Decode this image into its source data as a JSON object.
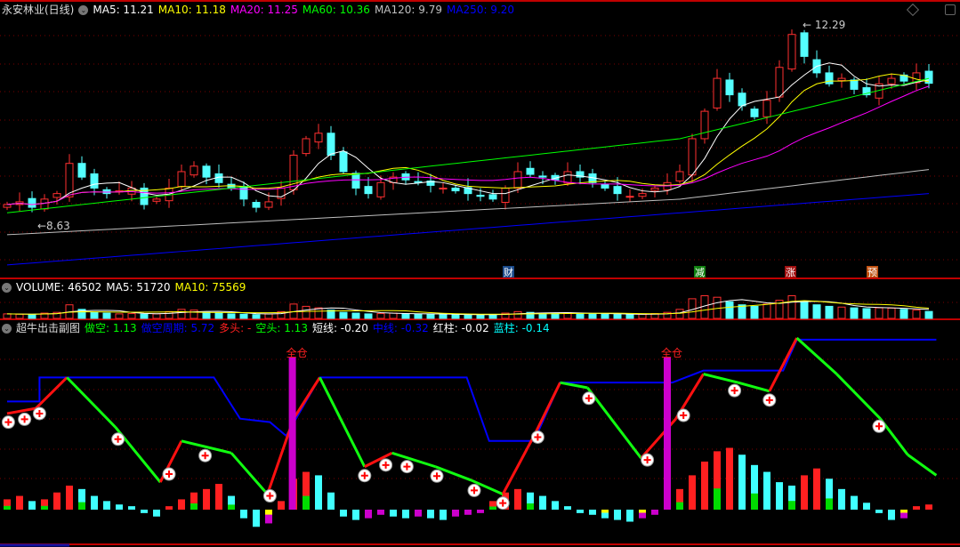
{
  "main": {
    "title": "永安林业(日线)",
    "ma": [
      {
        "label": "MA5: 11.21",
        "color": "#ffffff"
      },
      {
        "label": "MA10: 11.18",
        "color": "#ffff00"
      },
      {
        "label": "MA20: 11.25",
        "color": "#ff00ff"
      },
      {
        "label": "MA60: 10.36",
        "color": "#00ff00"
      },
      {
        "label": "MA120: 9.79",
        "color": "#c0c0c0"
      },
      {
        "label": "MA250: 9.20",
        "color": "#0000ff"
      }
    ],
    "high_label": "12.29",
    "low_label": "8.63",
    "events": [
      {
        "label": "财",
        "color": "#1a4a8a"
      },
      {
        "label": "减",
        "color": "#108010"
      },
      {
        "label": "涨",
        "color": "#a01010"
      },
      {
        "label": "预",
        "color": "#c05010"
      }
    ]
  },
  "volume": {
    "labels": [
      {
        "label": "VOLUME: 46502",
        "color": "#ffffff"
      },
      {
        "label": "MA5: 51720",
        "color": "#ffffff"
      },
      {
        "label": "MA10: 75569",
        "color": "#ffff00"
      }
    ]
  },
  "indicator": {
    "title": "超牛出击副图",
    "labels": [
      {
        "label": "做空: 1.13",
        "color": "#00ff00"
      },
      {
        "label": "做空周期: 5.72",
        "color": "#0000ff"
      },
      {
        "label": "多头: -",
        "color": "#ff2020"
      },
      {
        "label": "空头: 1.13",
        "color": "#00ff00"
      },
      {
        "label": "短线: -0.20",
        "color": "#ffffff"
      },
      {
        "label": "中线: -0.32",
        "color": "#0000ff"
      },
      {
        "label": "红柱: -0.02",
        "color": "#ffffff"
      },
      {
        "label": "蓝柱: -0.14",
        "color": "#00ffff"
      }
    ],
    "full_position_label": "全仓"
  },
  "chart_data": {
    "type": "candlestick",
    "title": "永安林业(日线)",
    "ylim": [
      7.67,
      12.4
    ],
    "closes": [
      9.0,
      9.05,
      8.95,
      9.1,
      9.2,
      9.75,
      9.5,
      9.3,
      9.2,
      9.25,
      9.3,
      9.0,
      9.1,
      9.3,
      9.6,
      9.7,
      9.5,
      9.4,
      9.3,
      9.1,
      8.95,
      9.05,
      9.3,
      9.9,
      10.2,
      10.3,
      9.9,
      9.6,
      9.3,
      9.2,
      9.4,
      9.5,
      9.45,
      9.4,
      9.35,
      9.3,
      9.25,
      9.2,
      9.15,
      9.1,
      9.3,
      9.6,
      9.55,
      9.5,
      9.45,
      9.6,
      9.5,
      9.4,
      9.3,
      9.2,
      9.15,
      9.2,
      9.3,
      9.4,
      9.6,
      10.2,
      10.7,
      11.3,
      11.0,
      10.8,
      10.6,
      10.9,
      11.5,
      12.1,
      11.7,
      11.4,
      11.2,
      11.3,
      11.1,
      11.0,
      11.2,
      11.3,
      11.25,
      11.4,
      11.21
    ],
    "ma250_range": [
      7.9,
      9.2
    ],
    "volumes": [
      30,
      28,
      25,
      35,
      40,
      90,
      60,
      40,
      35,
      30,
      32,
      28,
      30,
      45,
      60,
      55,
      40,
      35,
      30,
      28,
      25,
      30,
      45,
      95,
      80,
      70,
      55,
      40,
      35,
      30,
      32,
      35,
      30,
      28,
      27,
      26,
      25,
      24,
      24,
      26,
      35,
      45,
      40,
      35,
      32,
      38,
      34,
      30,
      28,
      26,
      25,
      28,
      32,
      40,
      60,
      130,
      150,
      140,
      110,
      90,
      80,
      95,
      120,
      150,
      110,
      90,
      80,
      75,
      70,
      65,
      70,
      68,
      60,
      55,
      46
    ],
    "oscillator_keypoints": [
      [
        0,
        56
      ],
      [
        2.3,
        59
      ],
      [
        4.8,
        77
      ],
      [
        8.7,
        48
      ],
      [
        12.3,
        16
      ],
      [
        14,
        40
      ],
      [
        18,
        33
      ],
      [
        20.9,
        9
      ],
      [
        23,
        53
      ],
      [
        25.1,
        77
      ],
      [
        28.7,
        25
      ],
      [
        30.9,
        33
      ],
      [
        34.4,
        25
      ],
      [
        37.3,
        17
      ],
      [
        39.8,
        9
      ],
      [
        42.3,
        43
      ],
      [
        44.4,
        74
      ],
      [
        46.6,
        71
      ],
      [
        50.9,
        30
      ],
      [
        53.7,
        53
      ],
      [
        55.9,
        79
      ],
      [
        58.7,
        74
      ],
      [
        61.2,
        69
      ],
      [
        63.4,
        100
      ],
      [
        66.6,
        79
      ],
      [
        70.1,
        53
      ],
      [
        72.3,
        32
      ],
      [
        74.6,
        20
      ]
    ],
    "period_keypoints": [
      [
        0,
        63
      ],
      [
        2.6,
        63
      ],
      [
        2.6,
        77
      ],
      [
        16.6,
        77
      ],
      [
        18.7,
        53
      ],
      [
        21.1,
        51
      ],
      [
        22.4,
        43
      ],
      [
        25.1,
        77
      ],
      [
        36.9,
        77
      ],
      [
        38.7,
        40
      ],
      [
        42.3,
        40
      ],
      [
        44.4,
        74
      ],
      [
        53.4,
        74
      ],
      [
        55.9,
        81
      ],
      [
        62.3,
        81
      ],
      [
        63.4,
        99
      ],
      [
        74.6,
        99
      ]
    ],
    "buy_markers": [
      0.1,
      1.4,
      2.6,
      8.9,
      13,
      15.9,
      21.1,
      28.7,
      30.4,
      32.1,
      34.5,
      37.5,
      39.8,
      42.6,
      46.7,
      51.4,
      54.3,
      58.4,
      61.2,
      70
    ],
    "full_position_at": [
      22.9,
      53
    ],
    "histogram": [
      6,
      8,
      5,
      6,
      10,
      14,
      12,
      8,
      5,
      3,
      2,
      -2,
      -4,
      2,
      6,
      10,
      12,
      15,
      8,
      -5,
      -10,
      -8,
      5,
      18,
      22,
      20,
      10,
      -4,
      -6,
      -5,
      -3,
      -4,
      -5,
      -4,
      -5,
      -6,
      -4,
      -3,
      -2,
      5,
      10,
      12,
      10,
      8,
      5,
      2,
      -2,
      -3,
      -5,
      -6,
      -7,
      -5,
      -3,
      2,
      12,
      20,
      28,
      34,
      36,
      32,
      26,
      22,
      16,
      14,
      20,
      24,
      18,
      12,
      8,
      4,
      -2,
      -6,
      -5,
      2,
      3
    ]
  }
}
